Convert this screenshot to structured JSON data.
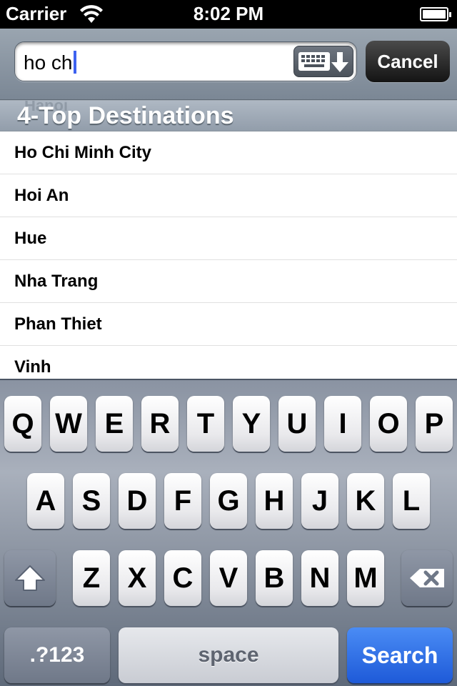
{
  "status_bar": {
    "carrier": "Carrier",
    "time": "8:02 PM",
    "wifi_icon": "wifi-icon",
    "battery_icon": "battery-icon"
  },
  "search": {
    "value": "ho ch",
    "cancel_label": "Cancel",
    "keyboard_toggle_icon": "keyboard-dismiss-icon"
  },
  "section": {
    "title": "4-Top Destinations",
    "partially_hidden_label": "Hanoi"
  },
  "results": [
    {
      "label": "Ho Chi Minh City"
    },
    {
      "label": "Hoi An"
    },
    {
      "label": "Hue"
    },
    {
      "label": "Nha Trang"
    },
    {
      "label": "Phan Thiet"
    },
    {
      "label": "Vinh"
    }
  ],
  "keyboard": {
    "row1": [
      "Q",
      "W",
      "E",
      "R",
      "T",
      "Y",
      "U",
      "I",
      "O",
      "P"
    ],
    "row2": [
      "A",
      "S",
      "D",
      "F",
      "G",
      "H",
      "J",
      "K",
      "L"
    ],
    "row3": [
      "Z",
      "X",
      "C",
      "V",
      "B",
      "N",
      "M"
    ],
    "shift_icon": "shift-icon",
    "delete_icon": "backspace-icon",
    "numbers_label": ".?123",
    "space_label": "space",
    "search_label": "Search"
  },
  "colors": {
    "search_key": "#1e5ad8",
    "caret": "#3d62f0"
  }
}
